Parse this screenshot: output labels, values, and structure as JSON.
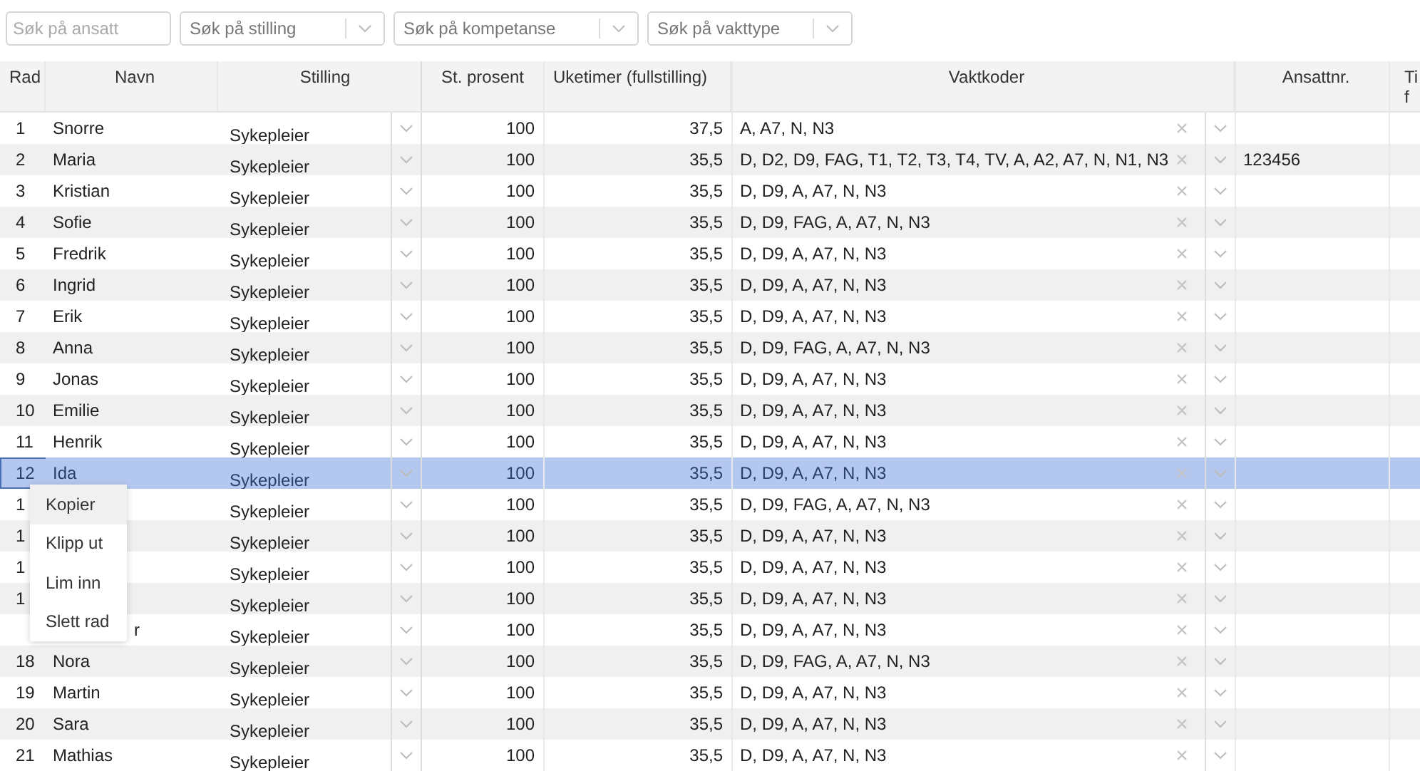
{
  "filters": [
    {
      "kind": "text",
      "placeholder": "Søk på ansatt"
    },
    {
      "kind": "select",
      "placeholder": "Søk på stilling"
    },
    {
      "kind": "select",
      "placeholder": "Søk på kompetanse"
    },
    {
      "kind": "select",
      "placeholder": "Søk på vakttype"
    }
  ],
  "table": {
    "columns": [
      "Rad",
      "Navn",
      "Stilling",
      "St. prosent",
      "Uketimer (fullstilling)",
      "Vaktkoder",
      "Ansattnr.",
      [
        "Ti",
        "f"
      ]
    ],
    "rows": [
      {
        "rad": "1",
        "name": "Snorre",
        "stilling": "Sykepleier",
        "prosent": "100",
        "uketimer": "37,5",
        "vaktkoder": "A, A7, N, N3",
        "selected": false
      },
      {
        "rad": "2",
        "name": "Maria",
        "stilling": "Sykepleier",
        "prosent": "100",
        "uketimer": "35,5",
        "vaktkoder": "D, D2, D9, FAG, T1, T2, T3, T4, TV, A, A2, A7, N, N1, N3",
        "ansattnr": "123456",
        "selected": false
      },
      {
        "rad": "3",
        "name": "Kristian",
        "stilling": "Sykepleier",
        "prosent": "100",
        "uketimer": "35,5",
        "vaktkoder": "D, D9, A, A7, N, N3",
        "selected": false
      },
      {
        "rad": "4",
        "name": "Sofie",
        "stilling": "Sykepleier",
        "prosent": "100",
        "uketimer": "35,5",
        "vaktkoder": "D, D9, FAG, A, A7, N, N3",
        "selected": false
      },
      {
        "rad": "5",
        "name": "Fredrik",
        "stilling": "Sykepleier",
        "prosent": "100",
        "uketimer": "35,5",
        "vaktkoder": "D, D9, A, A7, N, N3",
        "selected": false
      },
      {
        "rad": "6",
        "name": "Ingrid",
        "stilling": "Sykepleier",
        "prosent": "100",
        "uketimer": "35,5",
        "vaktkoder": "D, D9, A, A7, N, N3",
        "selected": false
      },
      {
        "rad": "7",
        "name": "Erik",
        "stilling": "Sykepleier",
        "prosent": "100",
        "uketimer": "35,5",
        "vaktkoder": "D, D9, A, A7, N, N3",
        "selected": false
      },
      {
        "rad": "8",
        "name": "Anna",
        "stilling": "Sykepleier",
        "prosent": "100",
        "uketimer": "35,5",
        "vaktkoder": "D, D9, FAG, A, A7, N, N3",
        "selected": false
      },
      {
        "rad": "9",
        "name": "Jonas",
        "stilling": "Sykepleier",
        "prosent": "100",
        "uketimer": "35,5",
        "vaktkoder": "D, D9, A, A7, N, N3",
        "selected": false
      },
      {
        "rad": "10",
        "name": "Emilie",
        "stilling": "Sykepleier",
        "prosent": "100",
        "uketimer": "35,5",
        "vaktkoder": "D, D9, A, A7, N, N3",
        "selected": false
      },
      {
        "rad": "11",
        "name": "Henrik",
        "stilling": "Sykepleier",
        "prosent": "100",
        "uketimer": "35,5",
        "vaktkoder": "D, D9, A, A7, N, N3",
        "selected": false
      },
      {
        "rad": "12",
        "name": "Ida",
        "stilling": "Sykepleier",
        "prosent": "100",
        "uketimer": "35,5",
        "vaktkoder": "D, D9, A, A7, N, N3",
        "selected": true
      },
      {
        "rad": "1",
        "stilling": "Sykepleier",
        "prosent": "100",
        "uketimer": "35,5",
        "vaktkoder": "D, D9, FAG, A, A7, N, N3",
        "selected": false
      },
      {
        "rad": "1",
        "stilling": "Sykepleier",
        "prosent": "100",
        "uketimer": "35,5",
        "vaktkoder": "D, D9, A, A7, N, N3",
        "selected": false
      },
      {
        "rad": "1",
        "stilling": "Sykepleier",
        "prosent": "100",
        "uketimer": "35,5",
        "vaktkoder": "D, D9, A, A7, N, N3",
        "selected": false
      },
      {
        "rad": "1",
        "stilling": "Sykepleier",
        "prosent": "100",
        "uketimer": "35,5",
        "vaktkoder": "D, D9, A, A7, N, N3",
        "selected": false
      },
      {
        "name": "r",
        "name_covered": true,
        "stilling": "Sykepleier",
        "prosent": "100",
        "uketimer": "35,5",
        "vaktkoder": "D, D9, A, A7, N, N3",
        "selected": false
      },
      {
        "rad": "18",
        "name": "Nora",
        "stilling": "Sykepleier",
        "prosent": "100",
        "uketimer": "35,5",
        "vaktkoder": "D, D9, FAG, A, A7, N, N3",
        "selected": false
      },
      {
        "rad": "19",
        "name": "Martin",
        "stilling": "Sykepleier",
        "prosent": "100",
        "uketimer": "35,5",
        "vaktkoder": "D, D9, A, A7, N, N3",
        "selected": false
      },
      {
        "rad": "20",
        "name": "Sara",
        "stilling": "Sykepleier",
        "prosent": "100",
        "uketimer": "35,5",
        "vaktkoder": "D, D9, A, A7, N, N3",
        "selected": false
      },
      {
        "rad": "21",
        "name": "Mathias",
        "stilling": "Sykepleier",
        "prosent": "100",
        "uketimer": "35,5",
        "vaktkoder": "D, D9, A, A7, N, N3",
        "selected": false
      }
    ]
  },
  "context_menu": [
    {
      "label": "Kopier",
      "selected": true
    },
    {
      "label": "Klipp ut",
      "selected": false
    },
    {
      "label": "Lim inn",
      "selected": false
    },
    {
      "label": "Slett rad",
      "selected": false
    }
  ]
}
